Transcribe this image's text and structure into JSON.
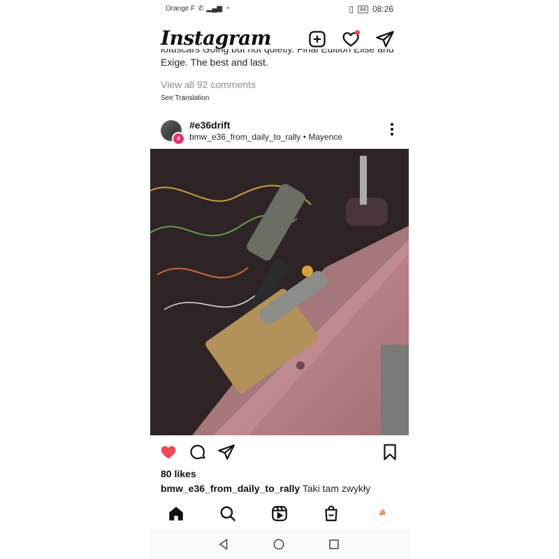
{
  "status_bar": {
    "carrier": "Orange F",
    "battery": "84",
    "time": "08:26"
  },
  "header": {
    "logo": "Instagram",
    "icons": [
      "new-post-icon",
      "heart-icon",
      "direct-message-icon"
    ]
  },
  "previous_post": {
    "caption_partial": "lotuscars Going but not quietly. Final Edition Elise and",
    "caption_line2": "Exige. The best and last.",
    "view_all_comments": "View all 92 comments",
    "see_translation": "See Translation"
  },
  "post": {
    "title": "#e36drift",
    "hashtag_badge": "#",
    "account": "bmw_e36_from_daily_to_rally",
    "separator": "•",
    "location": "Mayence",
    "likes": "80 likes",
    "caption_user": "bmw_e36_from_daily_to_rally",
    "caption_text": "Taki tam zwykły"
  },
  "bottom_nav": {
    "items": [
      "home-icon",
      "search-icon",
      "reels-icon",
      "shop-icon",
      "profile-avatar"
    ],
    "profile_label": "ॐ"
  },
  "colors": {
    "like_red": "#ed4956",
    "text": "#262626",
    "secondary_text": "#8e8e8e",
    "badge": "#e1306c"
  }
}
